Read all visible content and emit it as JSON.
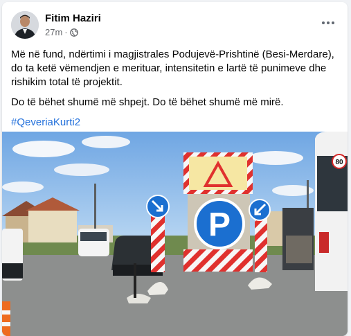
{
  "post": {
    "author": "Fitim Haziri",
    "time": "27m",
    "separator": "·",
    "privacy_icon": "globe-icon",
    "more_icon": "more-horizontal-icon",
    "paragraphs": [
      "Më në fund, ndërtimi i magjistrales Podujevë-Prishtinë (Besi-Merdare), do ta ketë vëmendjen e merituar, intensitetin e lartë të punimeve dhe rishikim total të projektit.",
      "Do të bëhet shumë më shpejt. Do të bëhet shumë më mirë."
    ],
    "hashtag": "#QeveriaKurti2"
  },
  "photo": {
    "speed_sign_value": "80",
    "parking_sign_letter": "P",
    "colors": {
      "sky": "#7fb2e8",
      "road": "#8d8f8e",
      "sign_blue": "#1b6fd0",
      "barrier_red": "#e0312e"
    }
  }
}
